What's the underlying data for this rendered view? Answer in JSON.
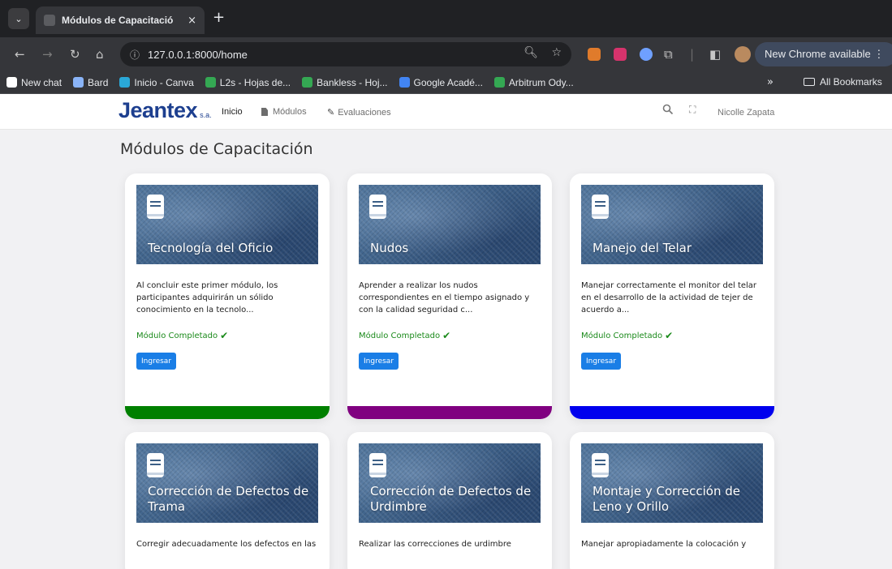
{
  "browser": {
    "tab": {
      "title": "Módulos de Capacitació",
      "close": "×"
    },
    "new_tab": "+",
    "url": "127.0.0.1:8000/home",
    "update_button": "New Chrome available ⋮",
    "bookmarks": [
      {
        "label": "New chat",
        "icon": "openai-icon",
        "color": "#ffffff"
      },
      {
        "label": "Bard",
        "icon": "sparkle-icon",
        "color": "#8ab4f8"
      },
      {
        "label": "Inicio - Canva",
        "icon": "canva-icon",
        "color": "#2aa8d8"
      },
      {
        "label": "L2s - Hojas de...",
        "icon": "sheets-icon",
        "color": "#34a853"
      },
      {
        "label": "Bankless - Hoj...",
        "icon": "sheets-icon",
        "color": "#34a853"
      },
      {
        "label": "Google Acadé...",
        "icon": "scholar-icon",
        "color": "#4285f4"
      },
      {
        "label": "Arbitrum Ody...",
        "icon": "sheets-icon",
        "color": "#34a853"
      }
    ],
    "bookmarks_more": "»",
    "all_bookmarks": "All Bookmarks"
  },
  "app": {
    "logo": "Jeantex",
    "logo_suffix": "s.a.",
    "nav": {
      "inicio": "Inicio",
      "modulos": "Módulos",
      "evaluaciones": "Evaluaciones"
    },
    "user": "Nicolle Zapata"
  },
  "page": {
    "title": "Módulos de Capacitación"
  },
  "cards": [
    {
      "title": "Tecnología del Oficio",
      "desc": "Al concluir este primer módulo, los participantes adquirirán un sólido conocimiento en la tecnolo...",
      "status": "Módulo Completado",
      "button": "Ingresar",
      "bar_color": "#008000"
    },
    {
      "title": "Nudos",
      "desc": "Aprender a realizar los nudos correspondientes en el tiempo asignado y con la calidad seguridad c...",
      "status": "Módulo Completado",
      "button": "Ingresar",
      "bar_color": "#800080"
    },
    {
      "title": "Manejo del Telar",
      "desc": "Manejar correctamente el monitor del telar en el desarrollo de la actividad de tejer de acuerdo a...",
      "status": "Módulo Completado",
      "button": "Ingresar",
      "bar_color": "#0000ee"
    },
    {
      "title": "Corrección de Defectos de Trama",
      "desc": "Corregir adecuadamente los defectos en las"
    },
    {
      "title": "Corrección de Defectos de Urdimbre",
      "desc": "Realizar las correcciones de urdimbre"
    },
    {
      "title": "Montaje y Corrección de Leno y Orillo",
      "desc": "Manejar apropiadamente la colocación y"
    }
  ]
}
